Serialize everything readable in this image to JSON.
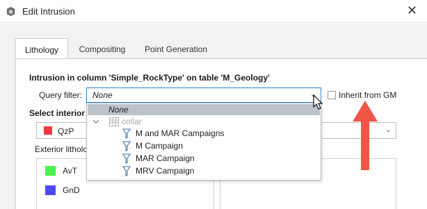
{
  "window": {
    "title": "Edit Intrusion",
    "close_glyph": "✕",
    "logo_icon": "app-logo-icon"
  },
  "tabs": [
    {
      "label": "Lithology",
      "active": true
    },
    {
      "label": "Compositing",
      "active": false
    },
    {
      "label": "Point Generation",
      "active": false
    }
  ],
  "form": {
    "heading": "Intrusion in column 'Simple_RockType' on table 'M_Geology'",
    "query_filter_label": "Query filter:",
    "query_filter_value": "None",
    "inherit_label": "Inherit from GM",
    "inherit_checked": false,
    "select_interior_label": "Select interior l",
    "interior_value": "QzP",
    "interior_color": "#f03a44",
    "exterior_label": "Exterior litholo",
    "exterior_suffix": ":",
    "exterior_items": [
      {
        "label": "AvT",
        "color": "#4cf34c"
      },
      {
        "label": "GnD",
        "color": "#4b49f2"
      }
    ]
  },
  "dropdown": {
    "none_label": "None",
    "group_label": "collar",
    "group_icon": "table-icon",
    "items": [
      {
        "label": "M and MAR Campaigns",
        "icon": "filter-icon"
      },
      {
        "label": "M Campaign",
        "icon": "filter-icon"
      },
      {
        "label": "MAR Campaign",
        "icon": "filter-icon"
      },
      {
        "label": "MRV Campaign",
        "icon": "filter-icon"
      }
    ]
  },
  "colors": {
    "accent": "#2f7fd1",
    "highlight": "#bcc3c9",
    "annotation_arrow": "#f05545"
  }
}
